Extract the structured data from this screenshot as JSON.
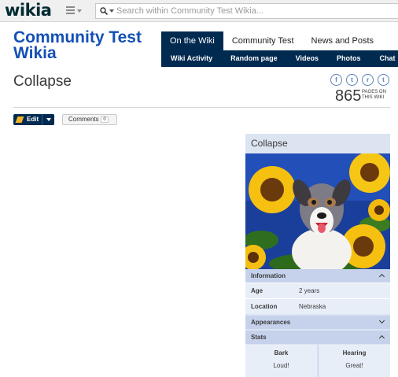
{
  "global_nav": {
    "logo": "wikia",
    "search_placeholder": "Search within Community Test Wikia..."
  },
  "wiki": {
    "title": "Community Test Wikia",
    "tabs": [
      {
        "label": "On the Wiki",
        "active": true
      },
      {
        "label": "Community Test",
        "active": false
      },
      {
        "label": "News and Posts",
        "active": false
      }
    ],
    "subnav": [
      "Wiki Activity",
      "Random page",
      "Videos",
      "Photos",
      "Chat"
    ]
  },
  "page": {
    "title": "Collapse",
    "pages_count": "865",
    "pages_label": "PAGES ON THIS WIKI",
    "share_icons": [
      "facebook-icon",
      "twitter-icon",
      "reddit-icon",
      "tumblr-icon"
    ],
    "share_glyphs": [
      "f",
      "t",
      "r",
      "t"
    ],
    "edit_label": "Edit",
    "comments_label": "Comments",
    "comments_count": "0"
  },
  "infobox": {
    "title": "Collapse",
    "image_subject": "Dog among sunflowers",
    "sections": {
      "information": "Information",
      "appearances": "Appearances",
      "stats": "Stats"
    },
    "rows": [
      {
        "label": "Age",
        "value": "2 years"
      },
      {
        "label": "Location",
        "value": "Nebraska"
      }
    ],
    "stats": [
      {
        "label": "Bark",
        "value": "Loud!"
      },
      {
        "label": "Hearing",
        "value": "Great!"
      }
    ]
  },
  "colors": {
    "brand_blue": "#1450b5",
    "nav_dark": "#002a50",
    "infobox_bg": "#dce4f2",
    "infobox_section": "#c6d2ec"
  }
}
